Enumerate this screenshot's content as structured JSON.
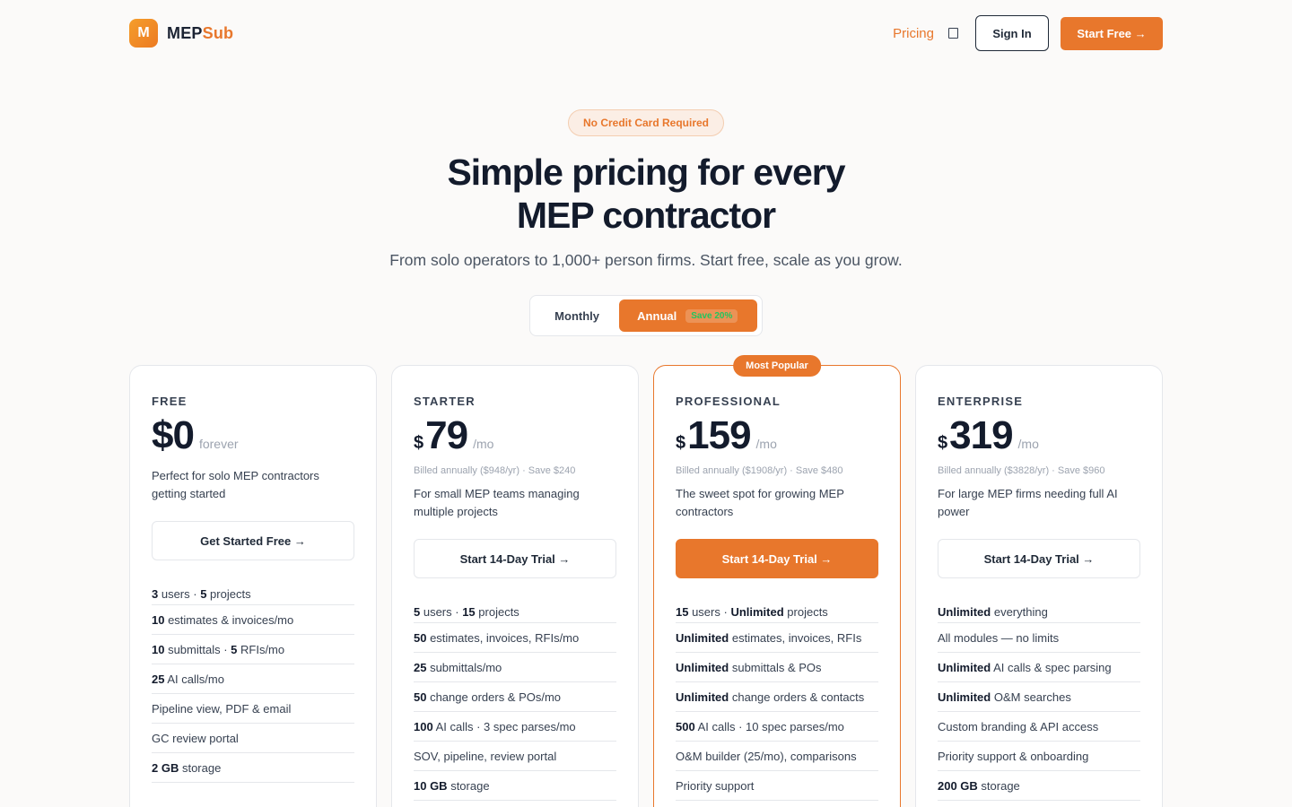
{
  "brand": {
    "logo_letter": "M",
    "name_part1": "MEP",
    "name_part2": "Sub"
  },
  "nav": {
    "pricing": "Pricing",
    "sign_in": "Sign In",
    "start_free": "Start Free →"
  },
  "hero": {
    "badge": "No Credit Card Required",
    "title_line1": "Simple pricing for every",
    "title_line2": "MEP contractor",
    "subtitle": "From solo operators to 1,000+ person firms. Start free, scale as you grow."
  },
  "billing": {
    "monthly": "Monthly",
    "annual": "Annual",
    "save": "Save 20%",
    "selected": "Annual"
  },
  "plans": [
    {
      "tier": "FREE",
      "currency": "",
      "amount": "$0",
      "period": "forever",
      "billed": "",
      "description": "Perfect for solo MEP contractors getting started",
      "cta": "Get Started Free →",
      "features": [
        [
          [
            "b",
            "3"
          ],
          [
            "t",
            " users · "
          ],
          [
            "b",
            "5"
          ],
          [
            "t",
            " projects"
          ]
        ],
        [
          [
            "b",
            "10"
          ],
          [
            "t",
            " estimates & invoices/mo"
          ]
        ],
        [
          [
            "b",
            "10"
          ],
          [
            "t",
            " submittals · "
          ],
          [
            "b",
            "5"
          ],
          [
            "t",
            " RFIs/mo"
          ]
        ],
        [
          [
            "b",
            "25"
          ],
          [
            "t",
            " AI calls/mo"
          ]
        ],
        [
          [
            "t",
            "Pipeline view, PDF & email"
          ]
        ],
        [
          [
            "t",
            "GC review portal"
          ]
        ],
        [
          [
            "b",
            "2 GB"
          ],
          [
            "t",
            " storage"
          ]
        ]
      ]
    },
    {
      "tier": "STARTER",
      "currency": "$",
      "amount": "79",
      "period": "/mo",
      "billed": "Billed annually ($948/yr) · Save $240",
      "description": "For small MEP teams managing multiple projects",
      "cta": "Start 14-Day Trial →",
      "features": [
        [
          [
            "b",
            "5"
          ],
          [
            "t",
            " users · "
          ],
          [
            "b",
            "15"
          ],
          [
            "t",
            " projects"
          ]
        ],
        [
          [
            "b",
            "50"
          ],
          [
            "t",
            " estimates, invoices, RFIs/mo"
          ]
        ],
        [
          [
            "b",
            "25"
          ],
          [
            "t",
            " submittals/mo"
          ]
        ],
        [
          [
            "b",
            "50"
          ],
          [
            "t",
            " change orders & POs/mo"
          ]
        ],
        [
          [
            "b",
            "100"
          ],
          [
            "t",
            " AI calls · 3 spec parses/mo"
          ]
        ],
        [
          [
            "t",
            "SOV, pipeline, review portal"
          ]
        ],
        [
          [
            "b",
            "10 GB"
          ],
          [
            "t",
            " storage"
          ]
        ]
      ]
    },
    {
      "tier": "PROFESSIONAL",
      "currency": "$",
      "amount": "159",
      "period": "/mo",
      "billed": "Billed annually ($1908/yr) · Save $480",
      "description": "The sweet spot for growing MEP contractors",
      "cta": "Start 14-Day Trial →",
      "popular": "Most Popular",
      "features": [
        [
          [
            "b",
            "15"
          ],
          [
            "t",
            " users · "
          ],
          [
            "b",
            "Unlimited"
          ],
          [
            "t",
            " projects"
          ]
        ],
        [
          [
            "b",
            "Unlimited"
          ],
          [
            "t",
            " estimates, invoices, RFIs"
          ]
        ],
        [
          [
            "b",
            "Unlimited"
          ],
          [
            "t",
            " submittals & POs"
          ]
        ],
        [
          [
            "b",
            "Unlimited"
          ],
          [
            "t",
            " change orders & contacts"
          ]
        ],
        [
          [
            "b",
            "500"
          ],
          [
            "t",
            " AI calls · 10 spec parses/mo"
          ]
        ],
        [
          [
            "t",
            "O&M builder (25/mo), comparisons"
          ]
        ],
        [
          [
            "t",
            "Priority support"
          ]
        ]
      ]
    },
    {
      "tier": "ENTERPRISE",
      "currency": "$",
      "amount": "319",
      "period": "/mo",
      "billed": "Billed annually ($3828/yr) · Save $960",
      "description": "For large MEP firms needing full AI power",
      "cta": "Start 14-Day Trial →",
      "features": [
        [
          [
            "b",
            "Unlimited"
          ],
          [
            "t",
            " everything"
          ]
        ],
        [
          [
            "t",
            "All modules — no limits"
          ]
        ],
        [
          [
            "b",
            "Unlimited"
          ],
          [
            "t",
            " AI calls & spec parsing"
          ]
        ],
        [
          [
            "b",
            "Unlimited"
          ],
          [
            "t",
            " O&M searches"
          ]
        ],
        [
          [
            "t",
            "Custom branding & API access"
          ]
        ],
        [
          [
            "t",
            "Priority support & onboarding"
          ]
        ],
        [
          [
            "b",
            "200 GB"
          ],
          [
            "t",
            " storage"
          ]
        ]
      ]
    }
  ],
  "colors": {
    "accent": "#e8772c",
    "dark": "#131b2c",
    "save_green": "#22c55e"
  }
}
